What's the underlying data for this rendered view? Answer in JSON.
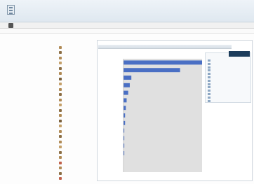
{
  "header": {
    "title": "",
    "logo_icon": "report-logo-icon"
  },
  "toolbar": {
    "label": "",
    "icon": "home-icon"
  },
  "breadcrumb": {
    "text": ""
  },
  "left_info": {
    "lines": [
      "",
      "",
      "",
      "",
      "",
      ""
    ]
  },
  "tree": {
    "items": [
      {
        "label": "",
        "color": "#b08a55"
      },
      {
        "label": "",
        "color": "#8c6e44"
      },
      {
        "label": "",
        "color": "#b08a55"
      },
      {
        "label": "",
        "color": "#c4a06a"
      },
      {
        "label": "",
        "color": "#8c6e44"
      },
      {
        "label": "",
        "color": "#b08a55"
      },
      {
        "label": "",
        "color": "#7a5f3a"
      },
      {
        "label": "",
        "color": "#c4a06a"
      },
      {
        "label": "",
        "color": "#b08a55"
      },
      {
        "label": "",
        "color": "#8c6e44"
      },
      {
        "label": "",
        "color": "#b08a55"
      },
      {
        "label": "",
        "color": "#c4a06a"
      },
      {
        "label": "",
        "color": "#8c6e44"
      },
      {
        "label": "",
        "color": "#b08a55"
      },
      {
        "label": "",
        "color": "#7a5f3a"
      },
      {
        "label": "",
        "color": "#c4a06a"
      },
      {
        "label": "",
        "color": "#b08a55"
      },
      {
        "label": "",
        "color": "#8c6e44"
      },
      {
        "label": "",
        "color": "#b08a55"
      },
      {
        "label": "",
        "color": "#c4a06a"
      },
      {
        "label": "",
        "color": "#8c6e44"
      },
      {
        "label": "",
        "color": "#b08a55"
      },
      {
        "label": "",
        "color": "#c0604a"
      },
      {
        "label": "",
        "color": "#b08a55"
      },
      {
        "label": "",
        "color": "#8c6e44"
      },
      {
        "label": "",
        "color": "#c0604a"
      }
    ]
  },
  "panel": {
    "tab_label": ""
  },
  "chart_data": {
    "type": "bar",
    "orientation": "horizontal",
    "categories": [
      "",
      "",
      "",
      "",
      "",
      "",
      "",
      "",
      "",
      "",
      "",
      "",
      "",
      "",
      ""
    ],
    "values": [
      100,
      72,
      10,
      8,
      6,
      4,
      3,
      2,
      2,
      1,
      1,
      1,
      1,
      0,
      0
    ],
    "bar_color": "#4a6fc4",
    "plot_background": "#e0e0e0",
    "title": "",
    "xlabel": "",
    "ylabel": "",
    "xlim": [
      0,
      100
    ],
    "grid": false,
    "legend": "right"
  },
  "legend": {
    "header_color": "#1d3d5c",
    "entries": [
      "",
      "",
      "",
      "",
      "",
      "",
      "",
      "",
      "",
      "",
      "",
      "",
      ""
    ]
  }
}
